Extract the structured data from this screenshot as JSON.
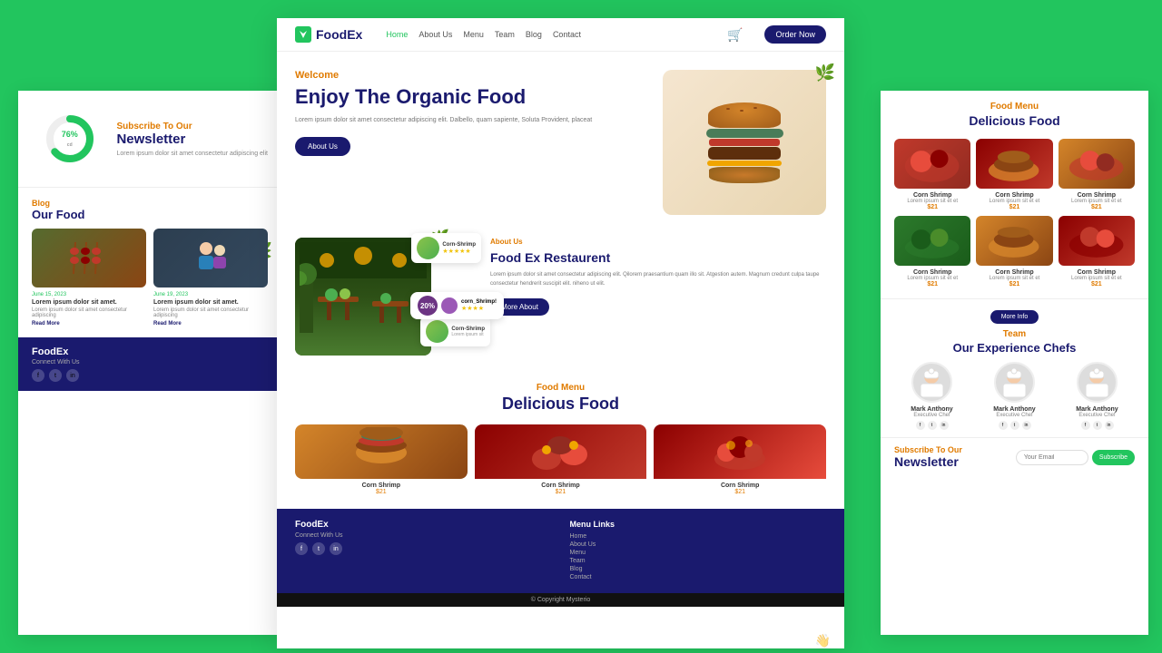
{
  "nav": {
    "logo": "FoodEx",
    "links": [
      "Home",
      "About Us",
      "Menu",
      "Team",
      "Blog",
      "Contact"
    ],
    "active_link": "Home",
    "order_button": "Order Now"
  },
  "hero": {
    "welcome": "Welcome",
    "title": "Enjoy The Organic Food",
    "description": "Lorem ipsum dolor sit amet consectetur adipiscing elit. Dalbello, quam sapiente, Soluta Provident, placeat",
    "button": "About Us"
  },
  "about": {
    "tag": "About Us",
    "title": "Food Ex Restaurent",
    "description": "Lorem ipsum dolor sit amet consectetur adipiscing elit. Qilorem praesantium quam illo sit. Atgestion autem. Magnum credunt culpa taupe consectetur hendrerit suscipit elit. niheno ut elit.",
    "button": "More About"
  },
  "food_menu": {
    "tag": "Food Menu",
    "title": "Delicious Food",
    "items": [
      {
        "name": "Corn Shrimp",
        "price": "$21",
        "img_class": "burger"
      },
      {
        "name": "Corn Shrimp",
        "price": "$21",
        "img_class": "kebab"
      },
      {
        "name": "Corn Shrimp",
        "price": "$21",
        "img_class": "curry"
      }
    ]
  },
  "team": {
    "tag": "Team",
    "title": "Our Experience Chefs",
    "button": "More Info",
    "chefs": [
      {
        "name": "Mark Anthony",
        "role": "Executive Chef"
      },
      {
        "name": "Mark Anthony",
        "role": "Executive Chef"
      },
      {
        "name": "Mark Anthony",
        "role": "Executive Chef"
      }
    ]
  },
  "footer": {
    "brand": "FoodEx",
    "connect_label": "Connect With Us",
    "menu_links_title": "Menu Links",
    "links": [
      "Home",
      "About Us",
      "Menu",
      "Team",
      "Blog",
      "Contact"
    ],
    "copyright": "© Copyright Mysterio"
  },
  "left_panel": {
    "newsletter": {
      "tag": "Subscribe To Our",
      "title": "Newsletter",
      "description": "Lorem ipsum dolor sit amet consectetur adipiscing elit"
    },
    "blog": {
      "tag": "Blog",
      "title": "Our Food",
      "items": [
        {
          "date": "June 15, 2023",
          "title": "Lorem ipsum dolor sit amet.",
          "desc": "Lorem ipsum dolor sit amet consectetur adipiscing elit"
        },
        {
          "date": "June 19, 2023",
          "title": "Lorem ipsum dolor sit amet.",
          "desc": "Lorem ipsum dolor sit amet consectetur adipiscing elit"
        }
      ]
    }
  },
  "right_panel": {
    "food_menu": {
      "tag": "Food Menu",
      "title": "Delicious Food",
      "items": [
        {
          "name": "Corn Shrimp",
          "desc": "Lorem ipsum sit et et consectetur",
          "price": "$21",
          "img": "dish1"
        },
        {
          "name": "Corn Shrimp",
          "desc": "Lorem ipsum sit et et consectetur",
          "price": "$21",
          "img": "dish2"
        },
        {
          "name": "Corn Shrimp",
          "desc": "Lorem ipsum sit et et consectetur",
          "price": "$21",
          "img": "dish3"
        },
        {
          "name": "Corn Shrimp",
          "desc": "Lorem ipsum sit et et consectetur",
          "price": "$21",
          "img": "dish4"
        },
        {
          "name": "Corn Shrimp",
          "desc": "Lorem ipsum sit et et consectetur",
          "price": "$21",
          "img": "dish5"
        },
        {
          "name": "Corn Shrimp",
          "desc": "Lorem ipsum sit et et consectetur",
          "price": "$21",
          "img": "dish6"
        }
      ]
    },
    "newsletter": {
      "tag": "Subscribe To Our",
      "title": "Newsletter",
      "input_placeholder": "Your Email",
      "button": "Subscribe"
    }
  },
  "colors": {
    "primary": "#1a1a6e",
    "accent": "#e07b00",
    "green": "#22c55e"
  }
}
